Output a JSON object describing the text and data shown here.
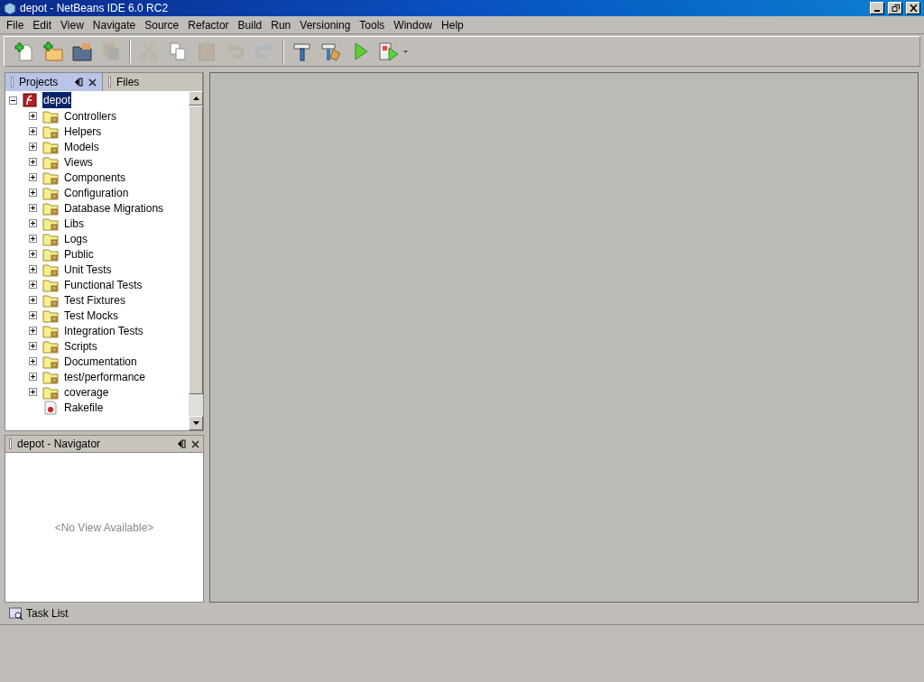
{
  "window": {
    "title": "depot - NetBeans IDE 6.0 RC2"
  },
  "menu": [
    "File",
    "Edit",
    "View",
    "Navigate",
    "Source",
    "Refactor",
    "Build",
    "Run",
    "Versioning",
    "Tools",
    "Window",
    "Help"
  ],
  "toolbar": [
    {
      "kind": "new-file",
      "disabled": false
    },
    {
      "kind": "new-project",
      "disabled": false
    },
    {
      "kind": "open-project",
      "disabled": false
    },
    {
      "kind": "save",
      "disabled": true
    },
    {
      "kind": "cut",
      "disabled": true
    },
    {
      "kind": "copy",
      "disabled": false
    },
    {
      "kind": "paste",
      "disabled": true
    },
    {
      "kind": "undo",
      "disabled": true
    },
    {
      "kind": "redo",
      "disabled": true
    },
    {
      "kind": "build",
      "disabled": false
    },
    {
      "kind": "clean-build",
      "disabled": false
    },
    {
      "kind": "run",
      "disabled": false
    },
    {
      "kind": "test",
      "disabled": false
    }
  ],
  "tabs": [
    {
      "label": "Projects",
      "selected": true
    },
    {
      "label": "Files",
      "selected": false
    }
  ],
  "tree": {
    "label": "depot",
    "selected": true,
    "expanded": true,
    "children": [
      {
        "label": "Controllers",
        "kind": "folder",
        "expanded": false
      },
      {
        "label": "Helpers",
        "kind": "folder",
        "expanded": false
      },
      {
        "label": "Models",
        "kind": "folder",
        "expanded": false
      },
      {
        "label": "Views",
        "kind": "folder",
        "expanded": false
      },
      {
        "label": "Components",
        "kind": "folder",
        "expanded": false
      },
      {
        "label": "Configuration",
        "kind": "folder",
        "expanded": false
      },
      {
        "label": "Database Migrations",
        "kind": "folder",
        "expanded": false
      },
      {
        "label": "Libs",
        "kind": "folder",
        "expanded": false
      },
      {
        "label": "Logs",
        "kind": "folder",
        "expanded": false
      },
      {
        "label": "Public",
        "kind": "folder",
        "expanded": false
      },
      {
        "label": "Unit Tests",
        "kind": "folder",
        "expanded": false
      },
      {
        "label": "Functional Tests",
        "kind": "folder",
        "expanded": false
      },
      {
        "label": "Test Fixtures",
        "kind": "folder",
        "expanded": false
      },
      {
        "label": "Test Mocks",
        "kind": "folder",
        "expanded": false
      },
      {
        "label": "Integration Tests",
        "kind": "folder",
        "expanded": false
      },
      {
        "label": "Scripts",
        "kind": "folder",
        "expanded": false
      },
      {
        "label": "Documentation",
        "kind": "folder",
        "expanded": false
      },
      {
        "label": "test/performance",
        "kind": "folder",
        "expanded": false
      },
      {
        "label": "coverage",
        "kind": "folder",
        "expanded": false
      },
      {
        "label": "Rakefile",
        "kind": "file"
      }
    ]
  },
  "navigator": {
    "title": "depot - Navigator",
    "message": "<No View Available>"
  },
  "task_list": {
    "label": "Task List"
  }
}
